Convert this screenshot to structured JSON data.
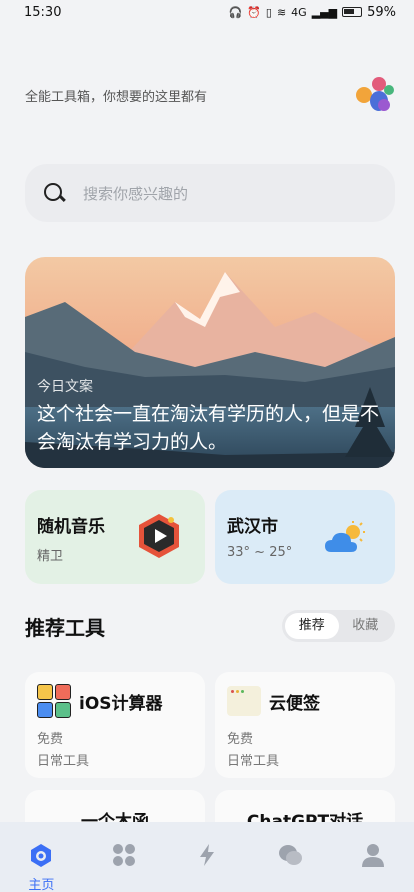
{
  "status": {
    "time": "15:30",
    "battery": "59%",
    "network": "4G"
  },
  "header": {
    "subtitle": "全能工具箱，你想要的这里都有"
  },
  "search": {
    "placeholder": "搜索你感兴趣的"
  },
  "hero": {
    "label": "今日文案",
    "quote": "这个社会一直在淘汰有学历的人，但是不会淘汰有学习力的人。"
  },
  "cards": {
    "music": {
      "title": "随机音乐",
      "subtitle": "精卫"
    },
    "weather": {
      "title": "武汉市",
      "subtitle": "33° ~ 25°"
    }
  },
  "section": {
    "title": "推荐工具",
    "tabs": [
      "推荐",
      "收藏"
    ],
    "active_tab": "推荐"
  },
  "tools": [
    {
      "name": "iOS计算器",
      "price": "免费",
      "category": "日常工具",
      "icon": "calculator-icon"
    },
    {
      "name": "云便签",
      "price": "免费",
      "category": "日常工具",
      "icon": "note-icon"
    },
    {
      "name": "一个木函",
      "icon": ""
    },
    {
      "name": "ChatGPT对话",
      "icon": ""
    }
  ],
  "tabbar": {
    "home_label": "主页",
    "items": [
      "home-icon",
      "apps-icon",
      "bolt-icon",
      "chat-icon",
      "profile-icon"
    ]
  },
  "colors": {
    "accent": "#3b6ff5",
    "music_card": "#e3f1e5",
    "weather_card": "#dbebf7"
  }
}
